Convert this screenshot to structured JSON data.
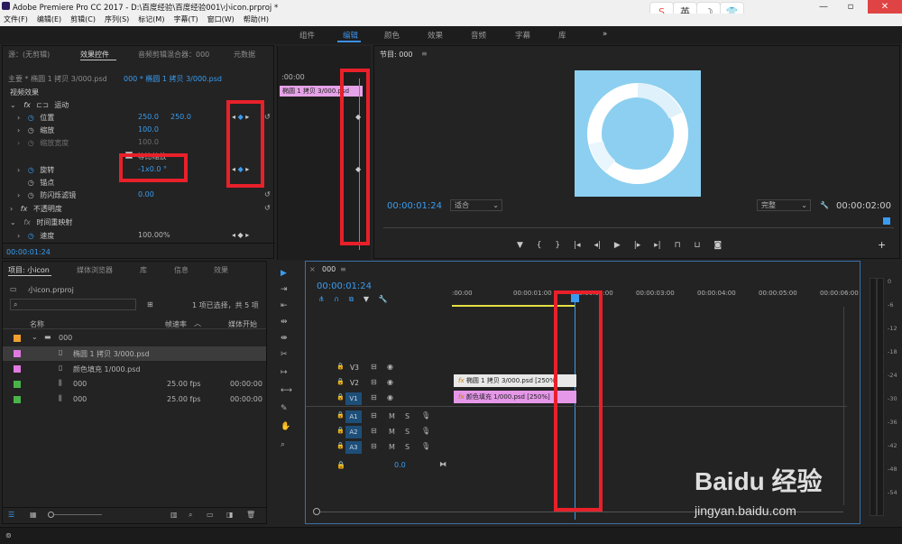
{
  "title_bar": {
    "text": "Adobe Premiere Pro CC 2017 - D:\\百度经验\\百度经验001\\小icon.prproj *"
  },
  "menu": [
    "文件(F)",
    "编辑(E)",
    "剪辑(C)",
    "序列(S)",
    "标记(M)",
    "字幕(T)",
    "窗口(W)",
    "帮助(H)"
  ],
  "workspaces": [
    {
      "label": "组件",
      "active": false
    },
    {
      "label": "编辑",
      "active": true
    },
    {
      "label": "颜色",
      "active": false
    },
    {
      "label": "效果",
      "active": false
    },
    {
      "label": "音频",
      "active": false
    },
    {
      "label": "字幕",
      "active": false
    },
    {
      "label": "库",
      "active": false
    }
  ],
  "browser_tags": [
    "S",
    "英",
    "☽",
    "👕"
  ],
  "effects_panel": {
    "tabs": [
      "源：(无剪辑)",
      "效果控件",
      "音频剪辑混合器：000",
      "元数据"
    ],
    "master": "主要 * 椭圆 1 拷贝 3/000.psd",
    "clip": "000 * 椭圆 1 拷贝 3/000.psd",
    "timecode_head": ":00:00",
    "mini_clip": "椭圆 1 拷贝 3/000.psd",
    "section_video": "视频效果",
    "motion": "运动",
    "position_label": "位置",
    "position_x": "250.0",
    "position_y": "250.0",
    "scale_label": "缩放",
    "scale_val": "100.0",
    "scale_w_label": "缩放宽度",
    "scale_w_val": "100.0",
    "uniform_label": "等比缩放",
    "rotation_label": "旋转",
    "rotation_val": "-1x0.0 °",
    "anchor_label": "锚点",
    "antiflicker_label": "防闪烁滤镜",
    "antiflicker_val": "0.00",
    "opacity_label": "不透明度",
    "remap_label": "时间重映射",
    "speed_label": "速度",
    "speed_val": "100.00%",
    "footer_time": "00:00:01:24"
  },
  "program_monitor": {
    "title": "节目: 000",
    "timecode": "00:00:01:24",
    "fit": "适合",
    "quality": "完整",
    "duration": "00:00:02:00"
  },
  "project_panel": {
    "tabs": [
      "项目: 小icon",
      "媒体浏览器",
      "库",
      "信息",
      "效果"
    ],
    "project_file": "小icon.prproj",
    "selection_info": "1 项已选择，共 5 项",
    "col_name": "名称",
    "col_fps": "帧速率",
    "col_start": "媒体开始",
    "items": [
      {
        "name": "000",
        "fps": "",
        "start": "",
        "color": "#f0a030",
        "kind": "folder"
      },
      {
        "name": "椭圆 1 拷贝 3/000.psd",
        "fps": "",
        "start": "",
        "color": "#e07ae0",
        "kind": "file",
        "selected": true
      },
      {
        "name": "颜色填充 1/000.psd",
        "fps": "",
        "start": "",
        "color": "#e07ae0",
        "kind": "file"
      },
      {
        "name": "000",
        "fps": "25.00 fps",
        "start": "00:00:00",
        "color": "#49b44a",
        "kind": "seq"
      },
      {
        "name": "000",
        "fps": "25.00 fps",
        "start": "00:00:00",
        "color": "#49b44a",
        "kind": "seq"
      }
    ]
  },
  "timeline": {
    "tab": "000",
    "timecode": "00:00:01:24",
    "ruler": [
      ":00:00",
      "00:00:01:00",
      "00:00:02:00",
      "00:00:03:00",
      "00:00:04:00",
      "00:00:05:00",
      "00:00:06:00"
    ],
    "video_tracks": [
      "V3",
      "V2",
      "V1"
    ],
    "audio_tracks": [
      "A1",
      "A2",
      "A3"
    ],
    "v1_btn": "V1",
    "clip_v2": "椭圆 1 拷贝 3/000.psd [250%]",
    "clip_v1": "颜色填充 1/000.psd [250%]",
    "master_val": "0.0",
    "meter_labels": [
      "0",
      "-6",
      "-12",
      "-18",
      "-24",
      "-30",
      "-36",
      "-42",
      "-48",
      "-54"
    ]
  },
  "watermark": {
    "brand": "Baidu 经验",
    "url": "jingyan.baidu.com"
  },
  "colors": {
    "accent": "#3a9cf0",
    "annotation": "#e8202a",
    "preview_bg": "#8ccff0"
  }
}
